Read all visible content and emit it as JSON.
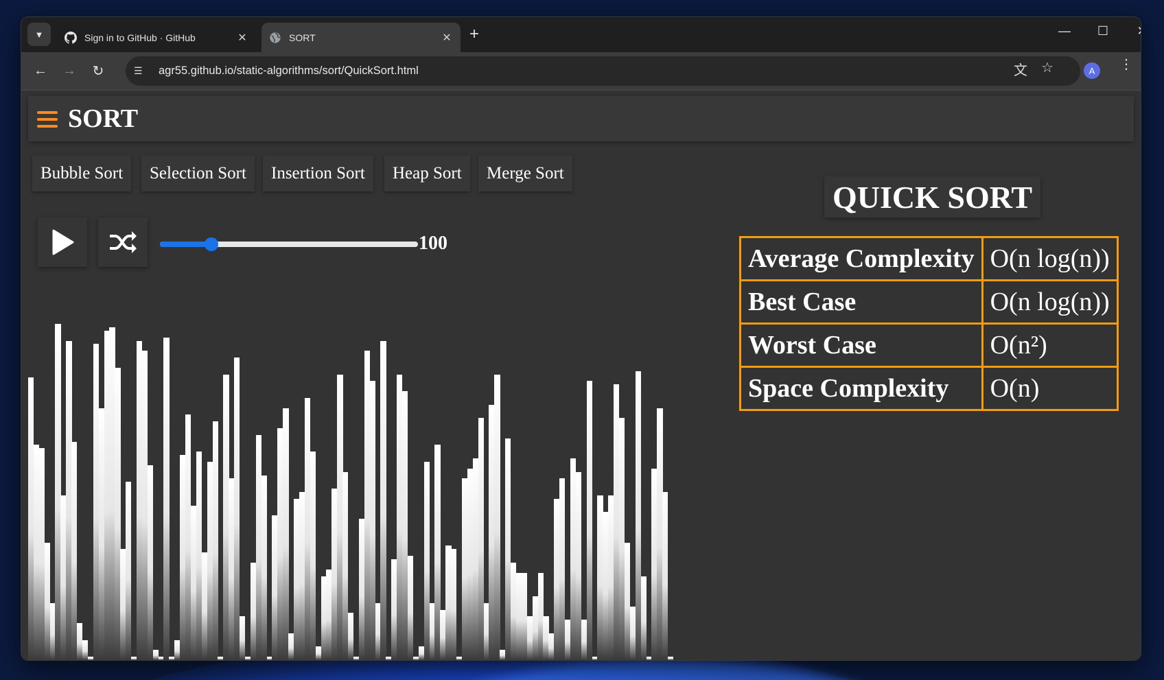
{
  "browser": {
    "tabs": [
      {
        "title": "Sign in to GitHub · GitHub",
        "favicon": "github-icon",
        "active": false
      },
      {
        "title": "SORT",
        "favicon": "globe-icon",
        "active": true
      }
    ],
    "url": "agr55.github.io/static-algorithms/sort/QuickSort.html",
    "profile_initial": "A"
  },
  "app": {
    "title": "SORT",
    "accent_color": "#ff8c1a",
    "nav": [
      "Bubble Sort",
      "Selection Sort",
      "Insertion Sort",
      "Heap Sort",
      "Merge Sort"
    ],
    "controls": {
      "play": "play-icon",
      "shuffle": "shuffle-icon"
    },
    "slider": {
      "value": "100",
      "min": 0,
      "max": 500,
      "fraction": 0.2,
      "color": "#1a73e8"
    }
  },
  "algorithm": {
    "name": "QUICK SORT",
    "complexity": [
      {
        "label": "Average Complexity",
        "value": "O(n log(n))"
      },
      {
        "label": "Best Case",
        "value": "O(n log(n))"
      },
      {
        "label": "Worst Case",
        "value": "O(n²)"
      },
      {
        "label": "Space Complexity",
        "value": "O(n)"
      }
    ],
    "border_color": "#f39c12"
  },
  "array_values": [
    84,
    64,
    63,
    35,
    17,
    100,
    49,
    95,
    65,
    11,
    6,
    1,
    94,
    75,
    98,
    99,
    87,
    33,
    53,
    1,
    95,
    92,
    58,
    3,
    1,
    96,
    1,
    6,
    61,
    73,
    46,
    62,
    32,
    59,
    71,
    1,
    85,
    54,
    90,
    13,
    1,
    29,
    67,
    55,
    1,
    43,
    69,
    75,
    8,
    48,
    50,
    78,
    62,
    4,
    25,
    27,
    51,
    85,
    56,
    14,
    1,
    42,
    92,
    83,
    17,
    95,
    1,
    30,
    85,
    80,
    31,
    1,
    4,
    59,
    17,
    64,
    15,
    34,
    33,
    1,
    54,
    57,
    60,
    72,
    17,
    76,
    85,
    3,
    66,
    29,
    26,
    26,
    13,
    19,
    26,
    13,
    8,
    48,
    54,
    12,
    60,
    56,
    12,
    83,
    1,
    49,
    44,
    49,
    82,
    72,
    35,
    16,
    86,
    25,
    1,
    57,
    75,
    50,
    1
  ]
}
